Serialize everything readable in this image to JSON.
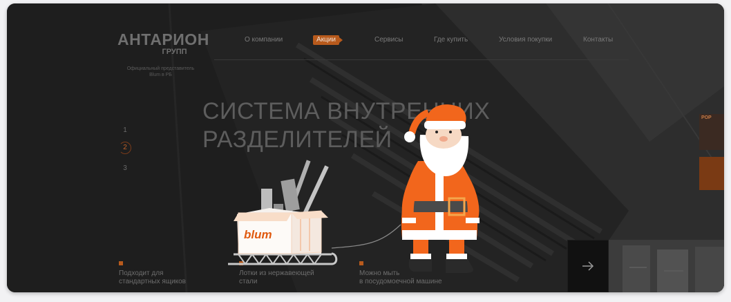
{
  "logo": {
    "title": "АНТАРИОН",
    "subtitle": "ГРУПП",
    "description": "Официальный представитель Blum в РБ"
  },
  "nav": {
    "items": [
      "О компании",
      "Акции",
      "Сервисы",
      "Где купить",
      "Условия покупки",
      "Контакты"
    ],
    "active": "Акции"
  },
  "hero": {
    "headline_line1": "СИСТЕМА ВНУТРЕННИХ",
    "headline_line2": "РАЗДЕЛИТЕЛЕЙ"
  },
  "slider": {
    "numbers": [
      "1",
      "2",
      "3"
    ],
    "active": "2"
  },
  "features": [
    {
      "line1": "Подходит для",
      "line2": "стандартных ящиков"
    },
    {
      "line1": "Лотки из нержавеющей",
      "line2": "стали"
    },
    {
      "line1": "Можно мыть",
      "line2": "в посудомоечной машине"
    }
  ],
  "promo": {
    "box_brand": "blum"
  },
  "side_thumb": {
    "label": "РОР"
  },
  "colors": {
    "accent": "#b85a1c",
    "santa_orange": "#f2661c",
    "background": "#1f1f1f"
  },
  "icons": {
    "next": "arrow-right-icon"
  }
}
